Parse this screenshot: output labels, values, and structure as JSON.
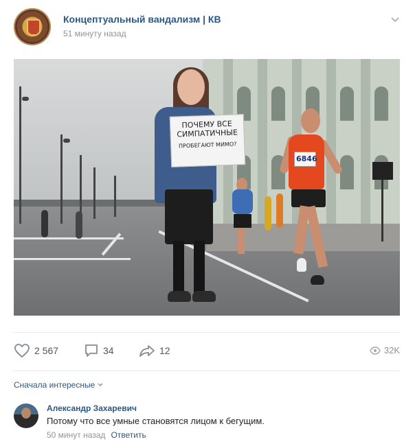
{
  "header": {
    "group_name": "Концептуальный вандализм | КВ",
    "time": "51 минуту назад"
  },
  "photo": {
    "sign_lines": [
      "ПОЧЕМУ ВСЕ",
      "СИМПАТИЧНЫЕ",
      "ПРОБЕГАЮТ МИМО?"
    ],
    "bib_number": "6846"
  },
  "actions": {
    "likes": "2 567",
    "comments": "34",
    "shares": "12",
    "views": "32K"
  },
  "comments_section": {
    "sort_label": "Сначала интересные",
    "items": [
      {
        "author": "Александр Захаревич",
        "text": "Потому что все умные становятся лицом к бегущим.",
        "time": "50 минут назад",
        "reply_label": "Ответить"
      }
    ]
  },
  "colors": {
    "link": "#2a5885",
    "muted": "#939393"
  }
}
